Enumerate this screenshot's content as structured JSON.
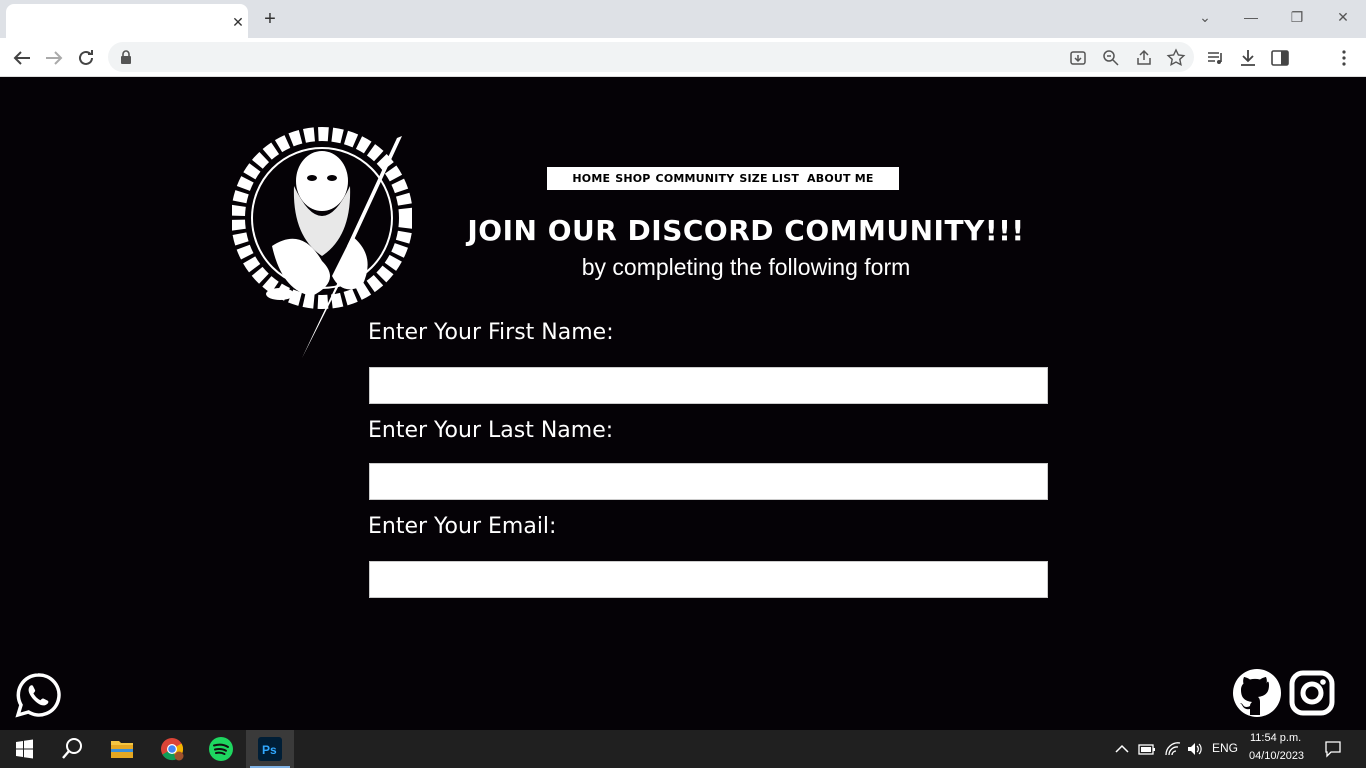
{
  "browser": {
    "tab_close": "✕",
    "new_tab": "+",
    "window_controls": [
      "⌄",
      "—",
      "❐",
      "✕"
    ]
  },
  "nav": {
    "items": [
      "HOME",
      "SHOP",
      "COMMUNITY",
      "SIZE LIST",
      "ABOUT ME"
    ]
  },
  "hero": {
    "headline": "JOIN OUR DISCORD COMMUNITY!!!",
    "subline": "by completing the following form"
  },
  "form": {
    "first_name_label": "Enter Your First Name:",
    "last_name_label": "Enter Your Last Name:",
    "email_label": "Enter Your Email:",
    "first_name_value": "",
    "last_name_value": "",
    "email_value": ""
  },
  "social": {
    "icons": [
      "whatsapp-icon",
      "github-icon",
      "instagram-icon"
    ]
  },
  "taskbar": {
    "lang": "ENG",
    "time": "11:54 p.m.",
    "date": "04/10/2023"
  },
  "colors": {
    "page_bg": "#050206",
    "text": "#ffffff",
    "taskbar_bg": "#202020",
    "chrome_bg": "#dee1e6"
  }
}
